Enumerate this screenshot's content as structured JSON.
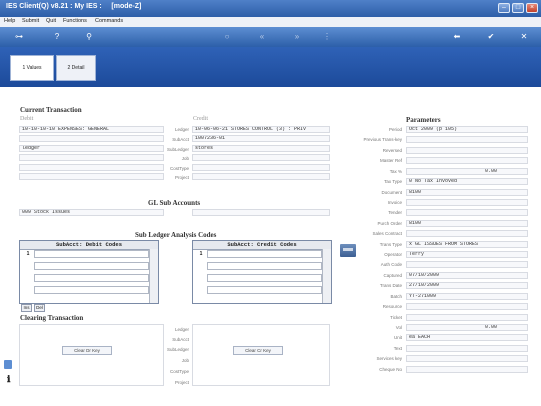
{
  "window": {
    "title": "IES Client(Q) v8.21 : My IES :     [mode-Z]"
  },
  "menu": [
    "Help",
    "Submit",
    "Quit",
    "Functions",
    "Commands"
  ],
  "tabs": [
    {
      "label": "1 Values"
    },
    {
      "label": "2 Detail"
    }
  ],
  "current_transaction": {
    "heading": "Current Transaction",
    "debit_header": "Debit",
    "credit_header": "Credit",
    "debit_ledger_value": "10-10-10-10 EXPENSES: GENERAL",
    "debit_subledger_value": "ledger",
    "labels": {
      "ledger": "Ledger",
      "subacct": "SubAcct",
      "subledger": "SubLedger",
      "job": "Job",
      "costtype": "CostType",
      "project": "Project"
    },
    "credit_ledger_value": "10-06-06-21 STORES CONTROL (3) : PRIV",
    "credit_subacct_value": "1007236-01",
    "credit_subledger_value": "stores"
  },
  "gl_sub_accounts": {
    "heading": "GL Sub Accounts",
    "debit_value": "009 Stock Issues",
    "credit_value": ""
  },
  "sub_ledger_analysis": {
    "heading": "Sub Ledger Analysis Codes",
    "debit_col": "SubAcct: Debit Codes",
    "credit_col": "SubAcct: Credit Codes",
    "debit_row_num": "1",
    "credit_row_num": "1",
    "ins_label": "Ins",
    "del_label": "Del"
  },
  "clearing": {
    "heading": "Clearing Transaction",
    "clear_dr_label": "Clear Dr Key",
    "clear_cr_label": "Clear Cr Key"
  },
  "parameters": {
    "heading": "Parameters",
    "rows": [
      {
        "label": "Period",
        "value": "Oct 2009 (p 105)"
      },
      {
        "label": "Previous Trans-key",
        "value": ""
      },
      {
        "label": "Reversed",
        "value": ""
      },
      {
        "label": "Master Ref",
        "value": ""
      },
      {
        "label": "Tax %",
        "value": "0.00"
      },
      {
        "label": "Tax Type",
        "value": "0 No Tax Invoved"
      },
      {
        "label": "Document",
        "value": "8100"
      },
      {
        "label": "Invoice",
        "value": ""
      },
      {
        "label": "Tender",
        "value": ""
      },
      {
        "label": "Purch Order",
        "value": "8100"
      },
      {
        "label": "Sales Contract",
        "value": ""
      },
      {
        "label": "Trans Type",
        "value": "x GL ISSUES FROM STORES"
      },
      {
        "label": "Operator",
        "value": "Terry"
      },
      {
        "label": "Auth Code",
        "value": ""
      },
      {
        "label": "Captured",
        "value": "07/10/2009"
      },
      {
        "label": "Trans Date",
        "value": "27/10/2009"
      },
      {
        "label": "Batch",
        "value": "YT-271009"
      },
      {
        "label": "Resource",
        "value": ""
      },
      {
        "label": "Ticket",
        "value": ""
      },
      {
        "label": "Vol",
        "value": "0.00"
      },
      {
        "label": "Unit",
        "value": "ea EACH"
      },
      {
        "label": "Text",
        "value": ""
      },
      {
        "label": "Services key",
        "value": ""
      },
      {
        "label": "Cheque No",
        "value": ""
      }
    ]
  },
  "colors": {
    "titlebar": "#2d5ea8",
    "band": "#1c4a9a",
    "accent": "#4f80c8"
  }
}
